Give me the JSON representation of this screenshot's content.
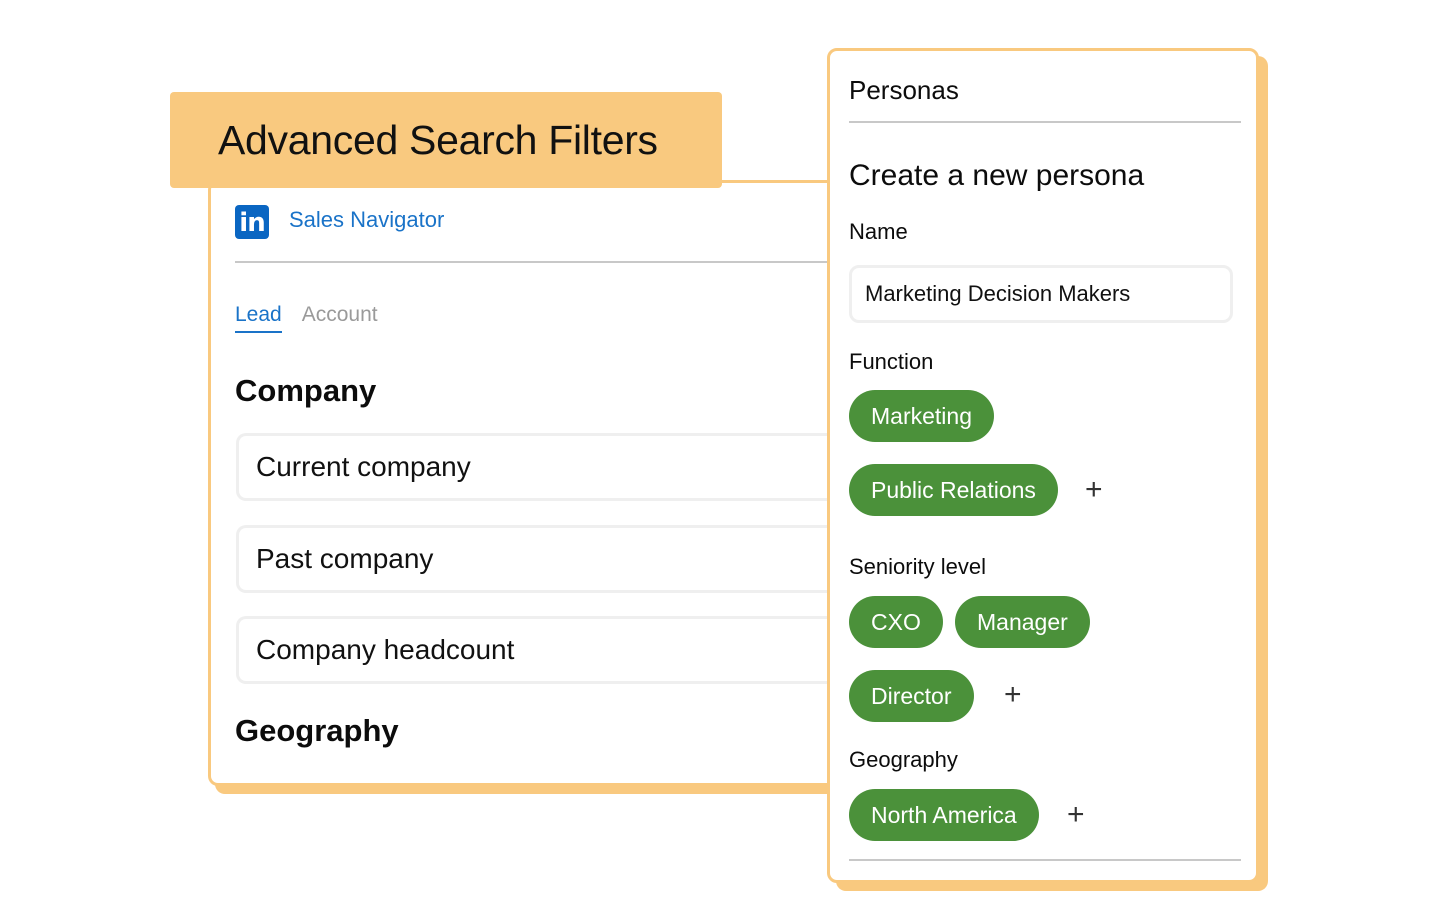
{
  "banner": {
    "title": "Advanced Search Filters"
  },
  "search_panel": {
    "logo_text": "in",
    "app_name": "Sales Navigator",
    "tabs": [
      {
        "label": "Lead",
        "active": true
      },
      {
        "label": "Account",
        "active": false
      }
    ],
    "sections": [
      {
        "heading": "Company",
        "filters": [
          "Current company",
          "Past company",
          "Company headcount"
        ]
      },
      {
        "heading": "Geography"
      }
    ]
  },
  "persona_panel": {
    "title": "Personas",
    "subtitle": "Create a new persona",
    "name": {
      "label": "Name",
      "value": "Marketing Decision Makers"
    },
    "function": {
      "label": "Function",
      "chips": [
        "Marketing",
        "Public Relations"
      ]
    },
    "seniority": {
      "label": "Seniority level",
      "chips": [
        "CXO",
        "Manager",
        "Director"
      ]
    },
    "geography": {
      "label": "Geography",
      "chips": [
        "North America"
      ]
    },
    "add_symbol": "+"
  },
  "colors": {
    "accent_border": "#f9c97f",
    "chip_green": "#4b913a",
    "link_blue": "#1a73c8",
    "linkedin_blue": "#0a66c2"
  },
  "icons": [
    "linkedin-logo-icon",
    "plus-icon"
  ]
}
